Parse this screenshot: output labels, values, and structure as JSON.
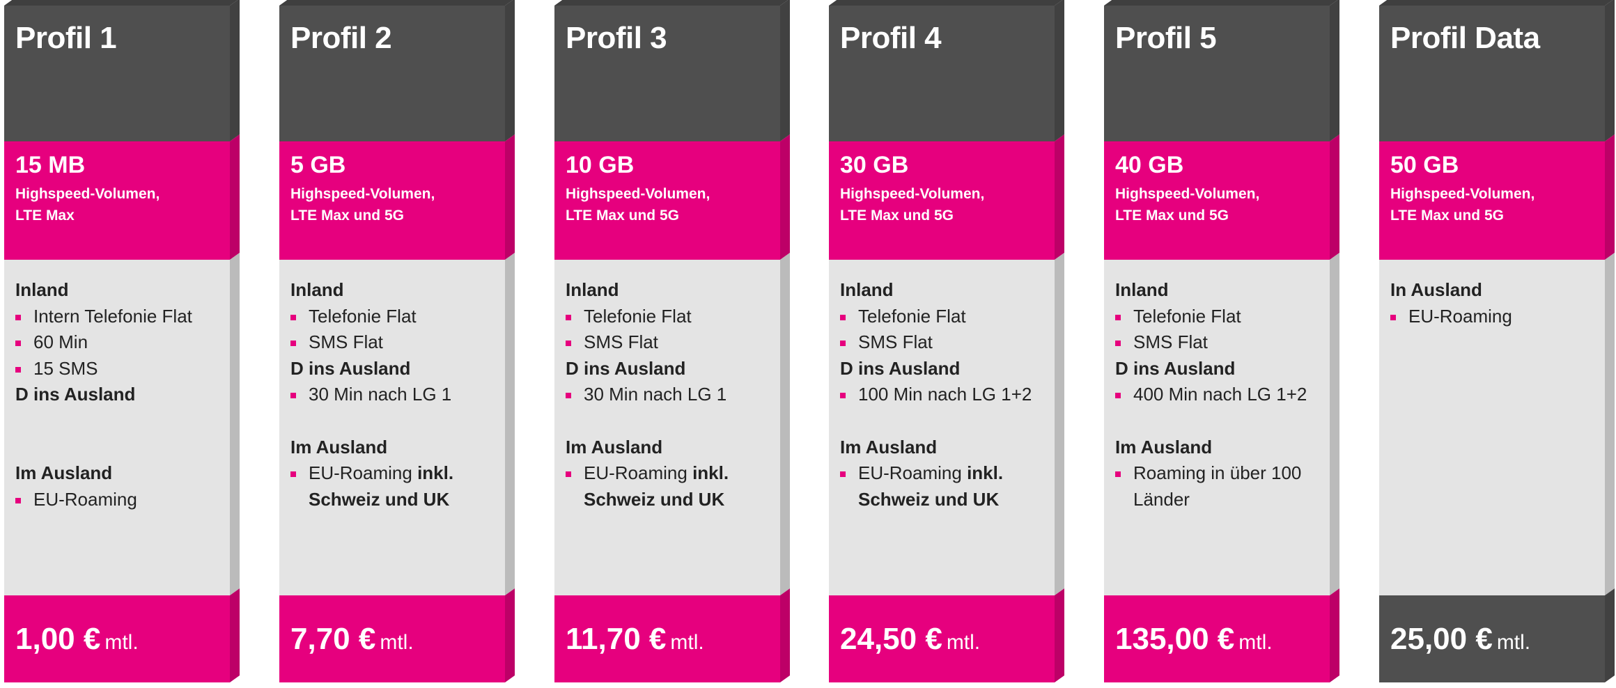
{
  "profiles": [
    {
      "title": "Profil 1",
      "volume": "15 MB",
      "volume_desc_line1": "Highspeed-Volumen,",
      "volume_desc_line2": "LTE Max",
      "price": "1,00 €",
      "price_unit": "mtl.",
      "features": [
        {
          "type": "head",
          "text": "Inland"
        },
        {
          "type": "item",
          "text": "Intern Telefonie Flat"
        },
        {
          "type": "item",
          "text": "60 Min"
        },
        {
          "type": "item",
          "text": "15 SMS"
        },
        {
          "type": "head",
          "text": "D ins Ausland"
        },
        {
          "type": "gap"
        },
        {
          "type": "gap"
        },
        {
          "type": "head",
          "text": "Im Ausland"
        },
        {
          "type": "item",
          "text": "EU-Roaming"
        }
      ]
    },
    {
      "title": "Profil 2",
      "volume": "5 GB",
      "volume_desc_line1": "Highspeed-Volumen,",
      "volume_desc_line2": "LTE Max und 5G",
      "price": "7,70 €",
      "price_unit": "mtl.",
      "features": [
        {
          "type": "head",
          "text": "Inland"
        },
        {
          "type": "item",
          "text": "Telefonie Flat"
        },
        {
          "type": "item",
          "text": "SMS Flat"
        },
        {
          "type": "head",
          "text": "D ins Ausland"
        },
        {
          "type": "item",
          "text": "30 Min nach LG 1"
        },
        {
          "type": "gap"
        },
        {
          "type": "head",
          "text": "Im Ausland"
        },
        {
          "type": "item",
          "text": "EU-Roaming ",
          "bold": "inkl. Schweiz und UK"
        }
      ]
    },
    {
      "title": "Profil 3",
      "volume": "10 GB",
      "volume_desc_line1": "Highspeed-Volumen,",
      "volume_desc_line2": "LTE Max und 5G",
      "price": "11,70 €",
      "price_unit": "mtl.",
      "features": [
        {
          "type": "head",
          "text": "Inland"
        },
        {
          "type": "item",
          "text": "Telefonie Flat"
        },
        {
          "type": "item",
          "text": "SMS Flat"
        },
        {
          "type": "head",
          "text": "D ins Ausland"
        },
        {
          "type": "item",
          "text": "30 Min nach LG 1"
        },
        {
          "type": "gap"
        },
        {
          "type": "head",
          "text": "Im Ausland"
        },
        {
          "type": "item",
          "text": "EU-Roaming ",
          "bold": "inkl. Schweiz und UK"
        }
      ]
    },
    {
      "title": "Profil 4",
      "volume": "30 GB",
      "volume_desc_line1": "Highspeed-Volumen,",
      "volume_desc_line2": "LTE Max und 5G",
      "price": "24,50 €",
      "price_unit": "mtl.",
      "features": [
        {
          "type": "head",
          "text": "Inland"
        },
        {
          "type": "item",
          "text": "Telefonie Flat"
        },
        {
          "type": "item",
          "text": "SMS Flat"
        },
        {
          "type": "head",
          "text": "D ins Ausland"
        },
        {
          "type": "item",
          "text": "100 Min nach LG 1+2"
        },
        {
          "type": "gap"
        },
        {
          "type": "head",
          "text": "Im Ausland"
        },
        {
          "type": "item",
          "text": "EU-Roaming ",
          "bold": "inkl. Schweiz und UK"
        }
      ]
    },
    {
      "title": "Profil 5",
      "volume": "40 GB",
      "volume_desc_line1": "Highspeed-Volumen,",
      "volume_desc_line2": "LTE Max und 5G",
      "price": "135,00 €",
      "price_unit": "mtl.",
      "features": [
        {
          "type": "head",
          "text": "Inland"
        },
        {
          "type": "item",
          "text": "Telefonie Flat"
        },
        {
          "type": "item",
          "text": "SMS Flat"
        },
        {
          "type": "head",
          "text": "D ins Ausland"
        },
        {
          "type": "item",
          "text": "400 Min nach LG 1+2"
        },
        {
          "type": "gap"
        },
        {
          "type": "head",
          "text": "Im Ausland"
        },
        {
          "type": "item",
          "text": "Roaming in über 100 Länder"
        }
      ]
    },
    {
      "title": "Profil Data",
      "volume": "50 GB",
      "volume_desc_line1": "Highspeed-Volumen,",
      "volume_desc_line2": "LTE Max und 5G",
      "price": "25,00 €",
      "price_unit": "mtl.",
      "price_dark": true,
      "features": [
        {
          "type": "head",
          "text": "In Ausland"
        },
        {
          "type": "item",
          "text": "EU-Roaming"
        }
      ]
    }
  ],
  "colors": {
    "magenta": "#e6007e",
    "dark_gray": "#4f4f4f",
    "light_gray": "#e4e4e4"
  }
}
